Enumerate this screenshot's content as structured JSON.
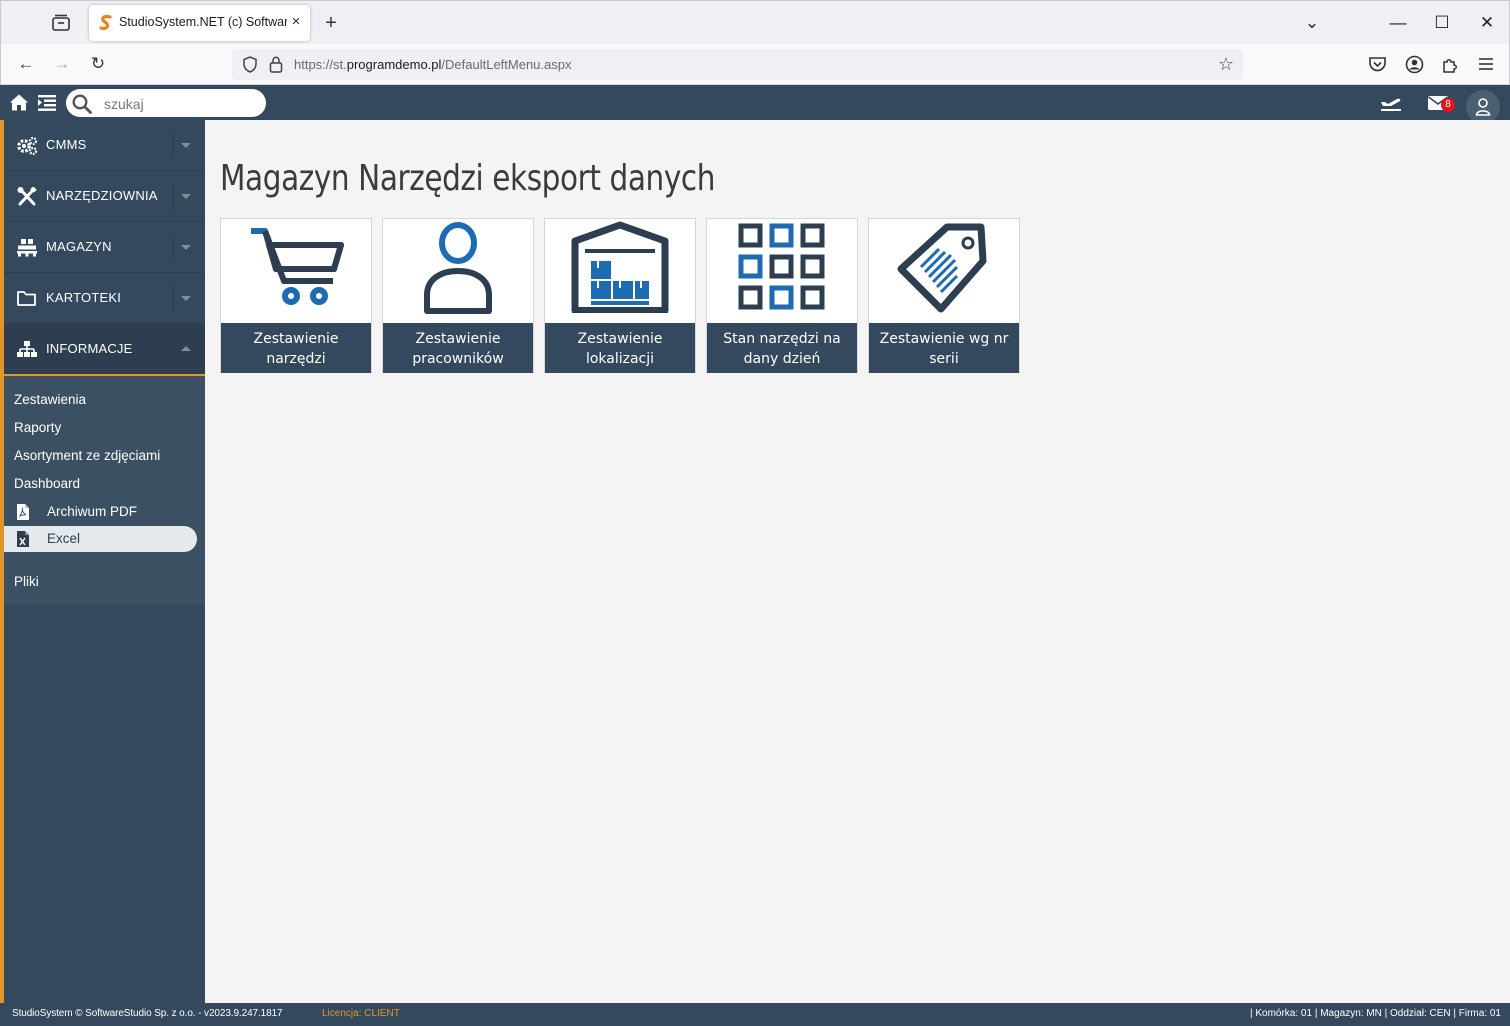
{
  "browser": {
    "tab_title": "StudioSystem.NET (c) SoftwareStudio",
    "url_prefix": "https://st.",
    "url_domain": "programdemo.pl",
    "url_path": "/DefaultLeftMenu.aspx",
    "new_tab": "+",
    "close_tab": "×",
    "window_buttons": [
      "⌄",
      "—",
      "☐",
      "✕"
    ],
    "back": "←",
    "forward": "→",
    "reload": "↻",
    "star": "☆"
  },
  "appbar": {
    "search_placeholder": "szukaj",
    "mail_count": "8"
  },
  "sidebar": {
    "sections": [
      {
        "label": "CMMS",
        "icon": "gears-icon"
      },
      {
        "label": "NARZĘDZIOWNIA",
        "icon": "tools-icon"
      },
      {
        "label": "MAGAZYN",
        "icon": "pallet-icon"
      },
      {
        "label": "KARTOTEKI",
        "icon": "folder-icon"
      },
      {
        "label": "INFORMACJE",
        "icon": "sitemap-icon"
      }
    ],
    "sub_links": [
      "Zestawienia",
      "Raporty",
      "Asortyment ze zdjęciami",
      "Dashboard"
    ],
    "sub_items": [
      {
        "label": "Archiwum PDF",
        "icon": "pdf-file-icon"
      },
      {
        "label": "Excel",
        "icon": "excel-file-icon"
      }
    ],
    "files_link": "Pliki"
  },
  "main": {
    "title": "Magazyn Narzędzi eksport danych",
    "tiles": [
      {
        "label": "Zestawienie narzędzi",
        "icon": "cart-icon"
      },
      {
        "label": "Zestawienie pracowników",
        "icon": "person-icon"
      },
      {
        "label": "Zestawienie lokalizacji",
        "icon": "warehouse-icon"
      },
      {
        "label": "Stan narzędzi na dany dzień",
        "icon": "grid-icon"
      },
      {
        "label": "Zestawienie wg nr serii",
        "icon": "tag-icon"
      }
    ]
  },
  "footer": {
    "left": "StudioSystem © SoftwareStudio Sp. z o.o. - v2023.9.247.1817",
    "license": "Licencja: CLIENT",
    "right": "| Komórka: 01 | Magazyn: MN | Oddział: CEN | Firma: 01"
  },
  "colors": {
    "header_bg": "#34495e",
    "accent": "#e1952a",
    "icon_dark": "#2c3e50",
    "icon_blue": "#1d6bb0"
  }
}
